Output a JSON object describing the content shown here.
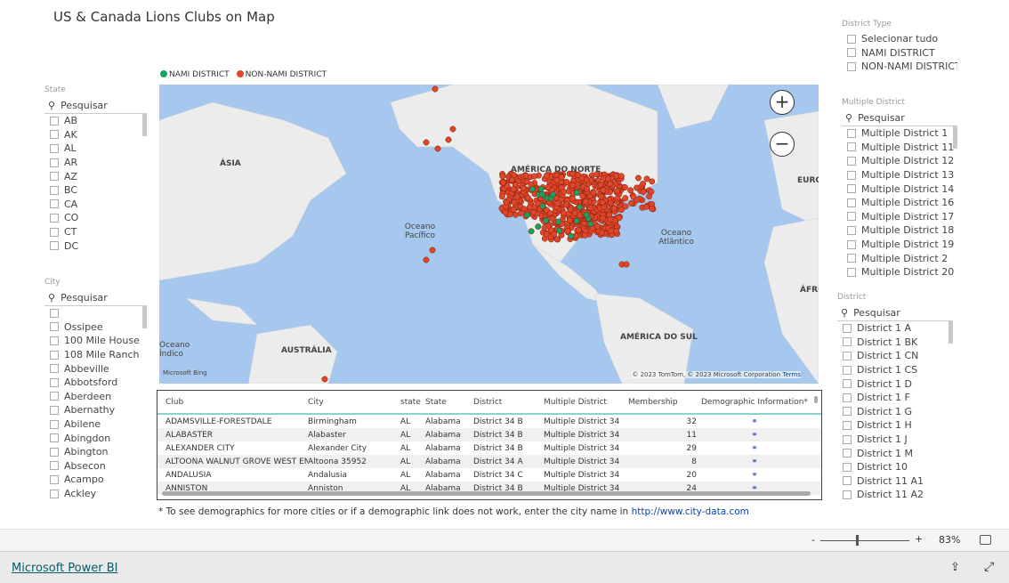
{
  "title": "US & Canada Lions Clubs on Map",
  "legend": [
    {
      "label": "NAMI DISTRICT",
      "color": "#1aa260"
    },
    {
      "label": "NON-NAMI DISTRICT",
      "color": "#e0462a"
    }
  ],
  "state_slicer": {
    "header": "State",
    "search_placeholder": "Pesquisar",
    "items": [
      "AB",
      "AK",
      "AL",
      "AR",
      "AZ",
      "BC",
      "CA",
      "CO",
      "CT",
      "DC"
    ]
  },
  "city_slicer": {
    "header": "City",
    "search_placeholder": "Pesquisar",
    "items": [
      "",
      "Ossipee",
      "100 Mile House",
      "108 Mile Ranch",
      "Abbeville",
      "Abbotsford",
      "Aberdeen",
      "Abernathy",
      "Abilene",
      "Abingdon",
      "Abington",
      "Absecon",
      "Acampo",
      "Ackley"
    ]
  },
  "district_type": {
    "header": "District Type",
    "items": [
      "Selecionar tudo",
      "NAMI DISTRICT",
      "NON-NAMI DISTRICT"
    ]
  },
  "multiple_district": {
    "header": "Multiple District",
    "search_placeholder": "Pesquisar",
    "items": [
      "Multiple District 1",
      "Multiple District 11",
      "Multiple District 12",
      "Multiple District 13",
      "Multiple District 14",
      "Multiple District 16",
      "Multiple District 17",
      "Multiple District 18",
      "Multiple District 19",
      "Multiple District 2",
      "Multiple District 20"
    ]
  },
  "district": {
    "header": "District",
    "search_placeholder": "Pesquisar",
    "items": [
      "District 1 A",
      "District 1 BK",
      "District 1 CN",
      "District 1 CS",
      "District 1 D",
      "District 1 F",
      "District 1 G",
      "District 1 H",
      "District 1 J",
      "District 1 M",
      "District 10",
      "District 11 A1",
      "District 11 A2"
    ]
  },
  "map": {
    "labels": [
      "ÁSIA",
      "AMÉRICA DO NORTE",
      "EURO",
      "Oceano Pacífico",
      "Oceano Atlântico",
      "ÁFRI",
      "AMÉRICA DO SUL",
      "AUSTRÁLIA",
      "Oceano Índico"
    ],
    "attribution": "© 2023 TomTom, © 2023 Microsoft Corporation",
    "terms": "Terms",
    "bing": "Microsoft Bing",
    "zoom_in": "+",
    "zoom_out": "−"
  },
  "table": {
    "columns": [
      "Club",
      "City",
      "state",
      "State",
      "District",
      "Multiple District",
      "Membership",
      "Demographic Information*"
    ],
    "rows": [
      [
        "ADAMSVILLE-FORESTDALE",
        "Birmingham",
        "AL",
        "Alabama",
        "District 34 B",
        "Multiple District 34",
        "32"
      ],
      [
        "ALABASTER",
        "Alabaster",
        "AL",
        "Alabama",
        "District 34 B",
        "Multiple District 34",
        "11"
      ],
      [
        "ALEXANDER CITY",
        "Alexander City",
        "AL",
        "Alabama",
        "District 34 B",
        "Multiple District 34",
        "29"
      ],
      [
        "ALTOONA WALNUT GROVE WEST END",
        "Altoona 35952",
        "AL",
        "Alabama",
        "District 34 A",
        "Multiple District 34",
        "8"
      ],
      [
        "ANDALUSIA",
        "Andalusia",
        "AL",
        "Alabama",
        "District 34 C",
        "Multiple District 34",
        "20"
      ],
      [
        "ANNISTON",
        "Anniston",
        "AL",
        "Alabama",
        "District 34 B",
        "Multiple District 34",
        "24"
      ]
    ]
  },
  "note": {
    "text": "* To see demographics for more cities or if a demographic link does not work, enter the city name in ",
    "link": "http://www.city-data.com"
  },
  "zoom": {
    "minus": "-",
    "plus": "+",
    "level": "83%",
    "level_fraction": 0.45
  },
  "footer": {
    "brand": "Microsoft Power BI"
  }
}
